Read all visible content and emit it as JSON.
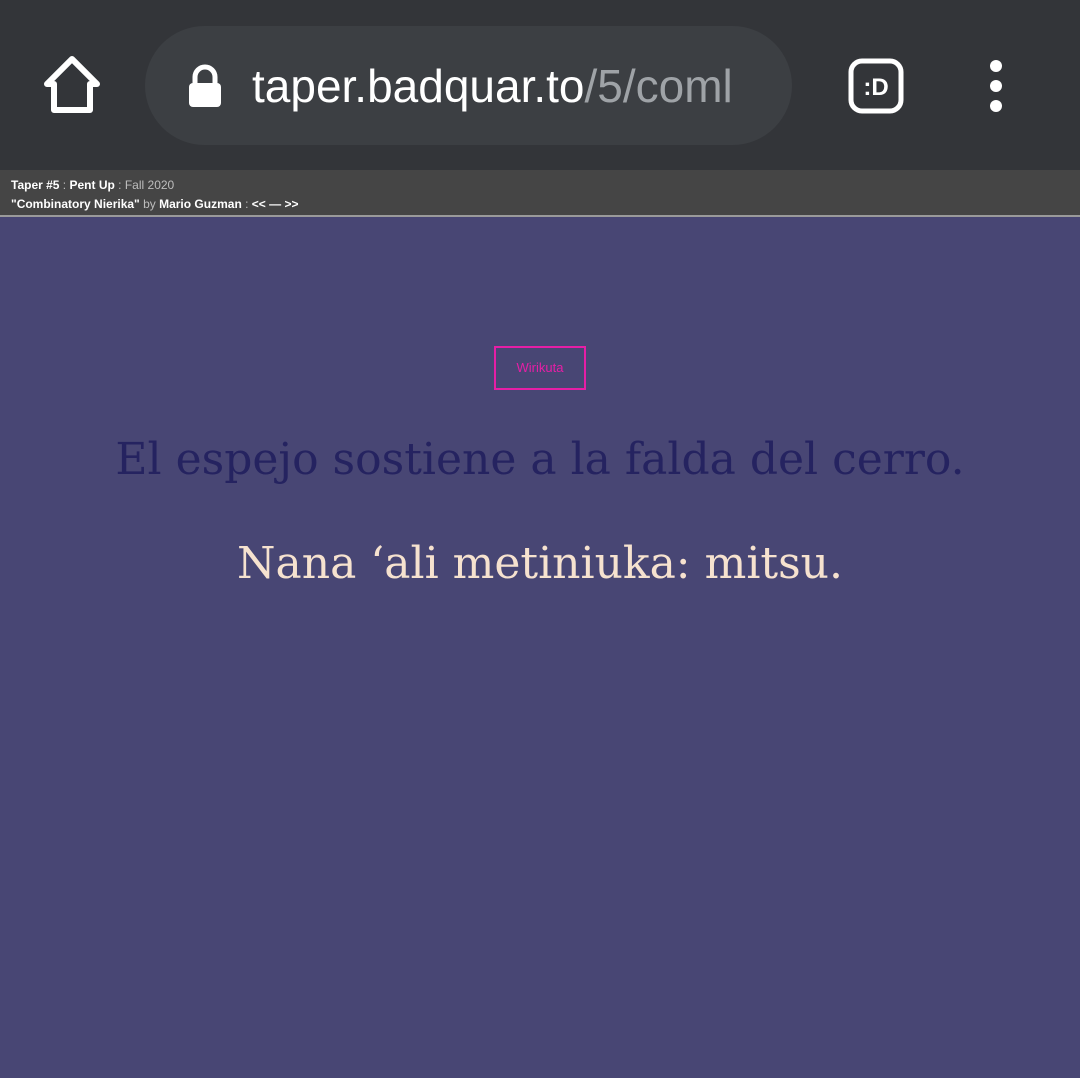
{
  "browser": {
    "url_host": "taper.badquar.to",
    "url_path": "/5/coml",
    "extension_label": ":D",
    "icons": {
      "home": "home-icon",
      "lock": "lock-icon",
      "extension": "extension-icon",
      "menu": "more-vert-icon"
    }
  },
  "infobar": {
    "issue": "Taper #5",
    "sep1": " : ",
    "issue_title": "Pent Up",
    "sep2": " : ",
    "season": "Fall 2020",
    "work_title": "\"Combinatory Nierika\"",
    "by": " by ",
    "author": "Mario Guzman",
    "sep3": " : ",
    "prev": "<<",
    "dash": " — ",
    "next": ">>"
  },
  "content": {
    "tag": "Wirikuta",
    "line1": "El espejo sostiene a la falda del cerro.",
    "line2": "Nana ‘ali metiniuka: mitsu."
  },
  "colors": {
    "toolbar_bg": "#333539",
    "url_bar_bg": "#3c3f43",
    "page_bg": "#484674",
    "tag_accent": "#e61ea6",
    "line1_color": "#252360",
    "line2_color": "#f6e2cf"
  }
}
